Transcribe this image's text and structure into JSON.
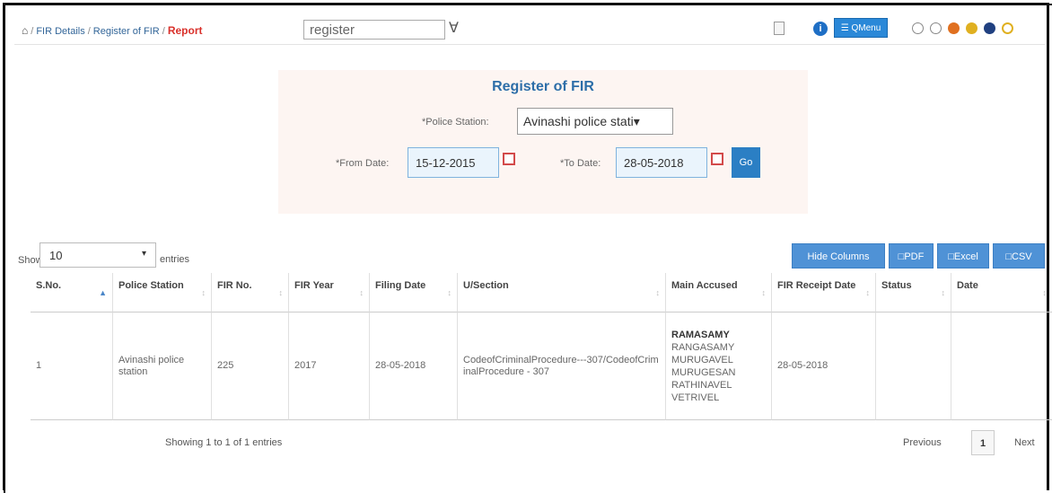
{
  "breadcrumb": {
    "home_icon": "home-icon",
    "items": [
      "FIR Details",
      "Register of FIR"
    ],
    "current": "Report"
  },
  "search": {
    "value": "register"
  },
  "toolbar": {
    "qmenu_label": "☰ QMenu"
  },
  "colors": {
    "accent": "#2b7fc4",
    "title": "#2d6ea8",
    "dots": [
      "#ffffff",
      "#ffffff",
      "#e07020",
      "#e0b020",
      "#204080",
      "#e0b020"
    ]
  },
  "form": {
    "title": "Register of FIR",
    "police_station_label": "*Police Station:",
    "police_station_value": "Avinashi police stati▾",
    "from_date_label": "*From Date:",
    "from_date_value": "15-12-2015",
    "to_date_label": "*To Date:",
    "to_date_value": "28-05-2018",
    "go_label": "Go"
  },
  "table_controls": {
    "show_label": "Show",
    "page_length": "10",
    "entries_label": "entries",
    "buttons": {
      "hide_columns": "Hide Columns",
      "pdf": "PDF",
      "excel": "Excel",
      "csv": "CSV"
    }
  },
  "table": {
    "headers": [
      "S.No.",
      "Police Station",
      "FIR No.",
      "FIR Year",
      "Filing Date",
      "U/Section",
      "Main Accused",
      "FIR Receipt Date",
      "Status",
      "Date"
    ],
    "rows": [
      {
        "sno": "1",
        "police_station": "Avinashi police station",
        "fir_no": "225",
        "fir_year": "2017",
        "filing_date": "28-05-2018",
        "u_section": "CodeofCriminalProcedure---307/CodeofCriminalProcedure - 307",
        "accused": [
          "RAMASAMY",
          "RANGASAMY",
          "MURUGAVEL",
          "MURUGESAN",
          "RATHINAVEL",
          "VETRIVEL"
        ],
        "fir_receipt_date": "28-05-2018",
        "status": "",
        "date": ""
      }
    ]
  },
  "pagination": {
    "info": "Showing 1 to 1 of 1 entries",
    "previous": "Previous",
    "page": "1",
    "next": "Next"
  }
}
